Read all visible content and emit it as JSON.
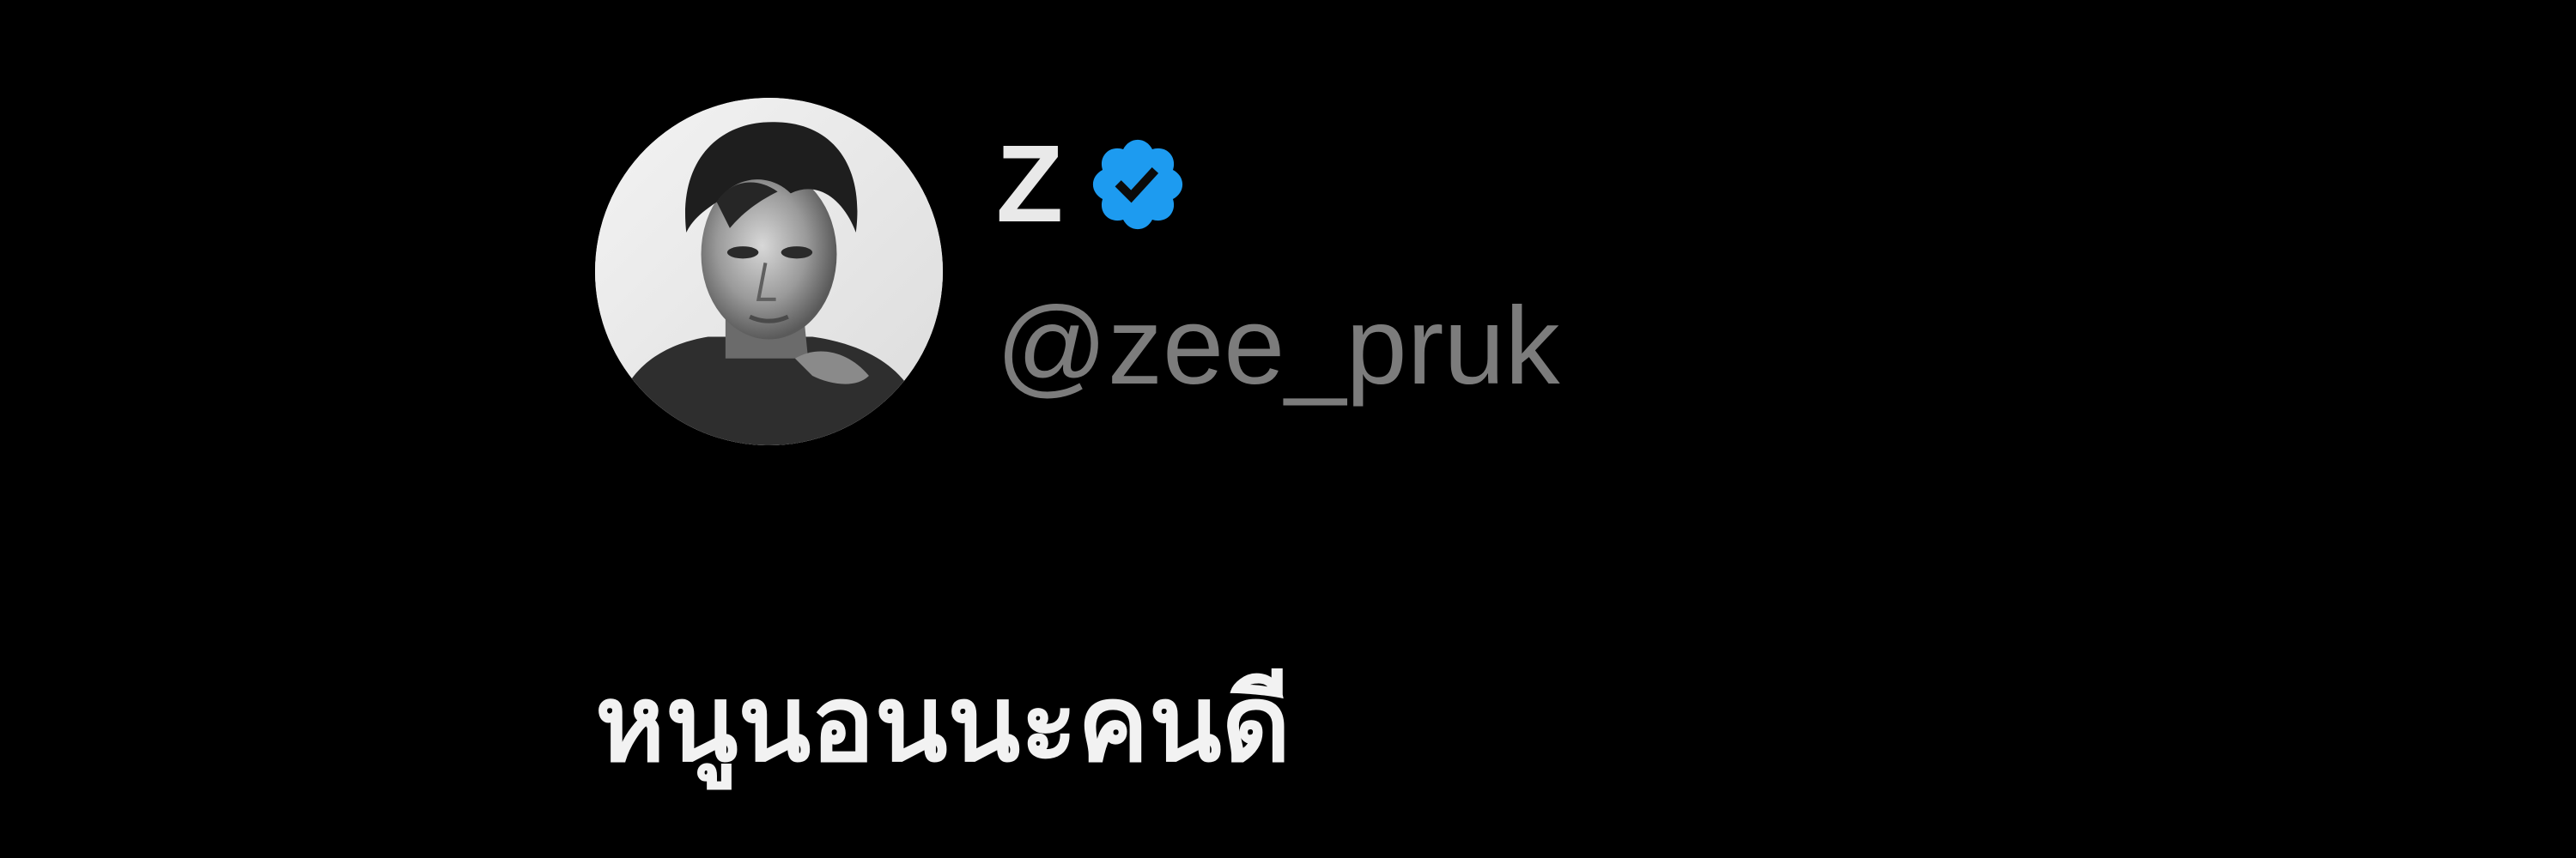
{
  "profile": {
    "display_name": "Z",
    "handle": "@zee_pruk",
    "verified": true,
    "avatar_alt": "avatar"
  },
  "tweet": {
    "text": "หนูนอนนะคนดี"
  },
  "colors": {
    "background": "#000000",
    "display_name": "#e9e9e9",
    "handle": "#7c7c7c",
    "tweet_text": "#f2f2f2",
    "verified_badge": "#1d9bf0"
  }
}
